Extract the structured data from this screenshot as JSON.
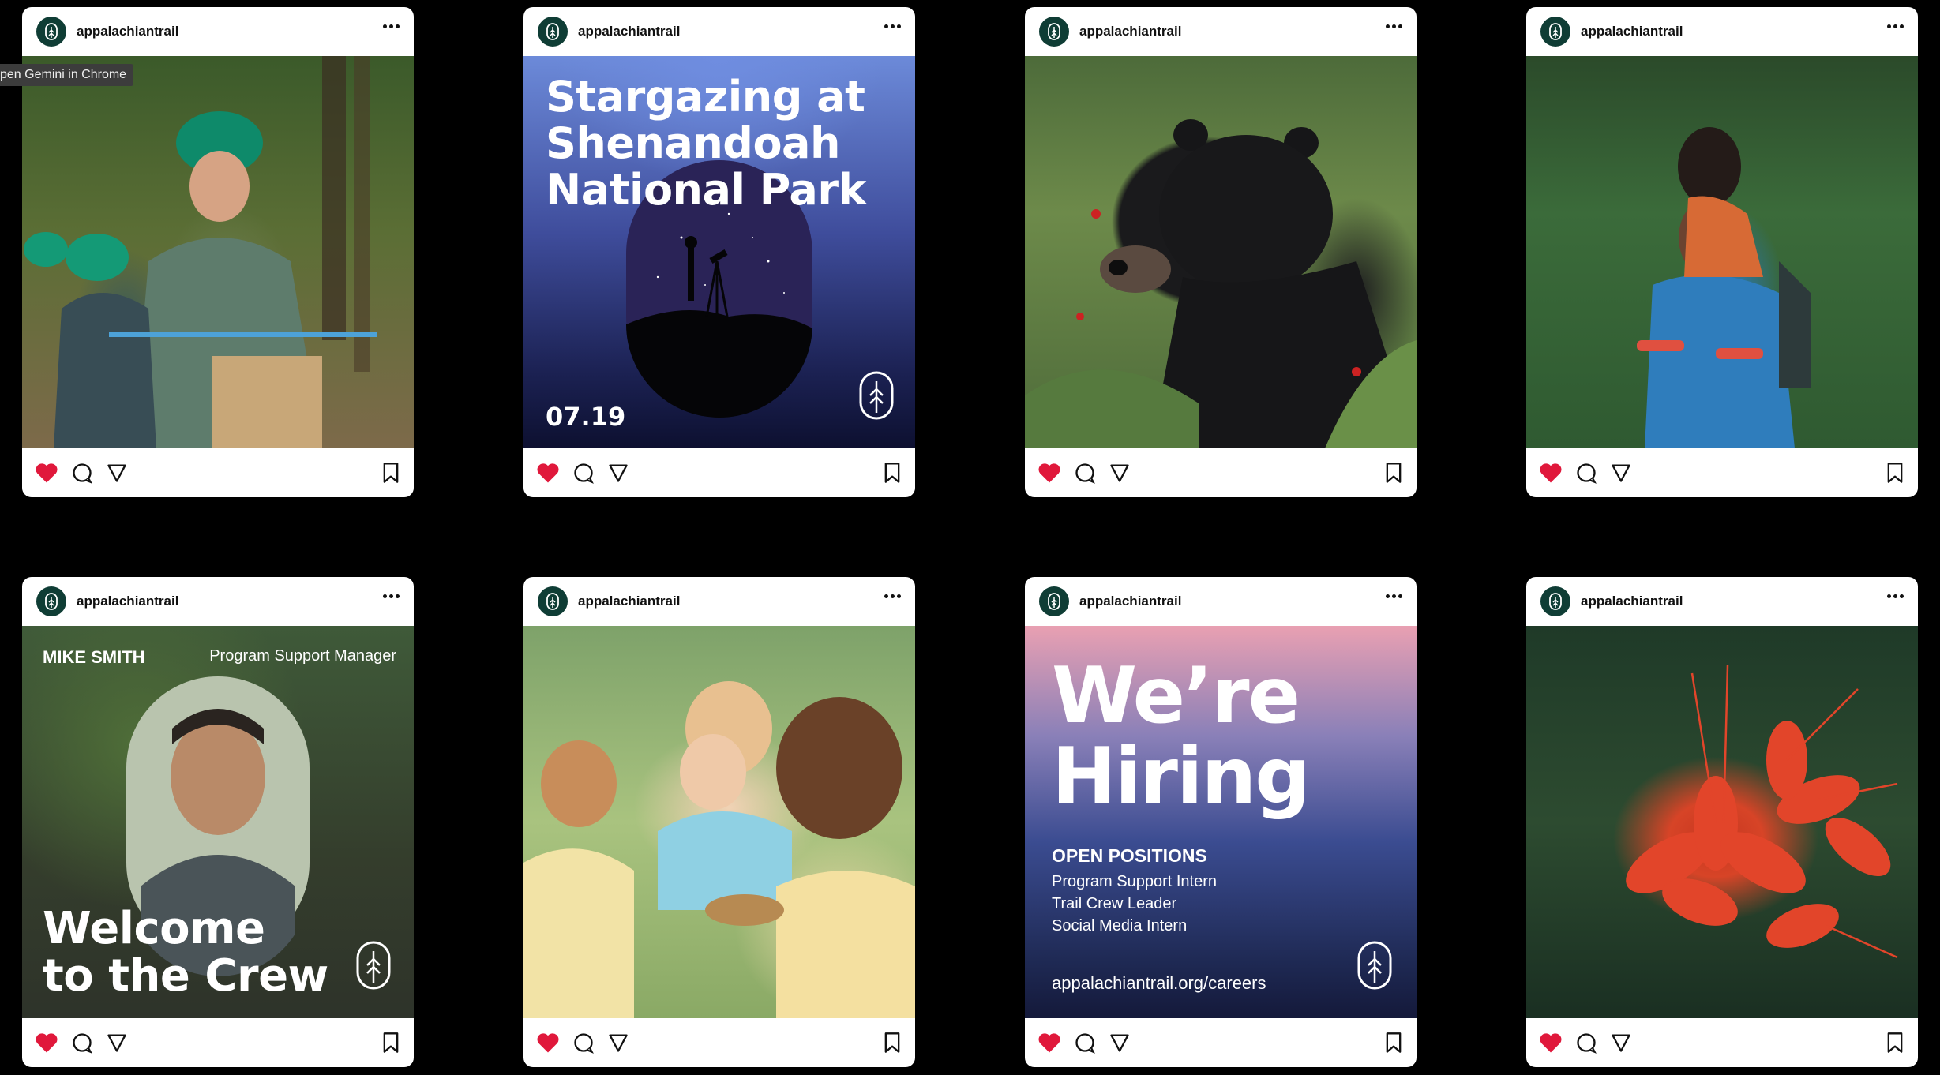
{
  "tooltip": "pen Gemini in Chrome",
  "posts": [
    {
      "username": "appalachiantrail"
    },
    {
      "username": "appalachiantrail",
      "title_lines": [
        "Stargazing at",
        "Shenandoah",
        "National Park"
      ],
      "date": "07.19"
    },
    {
      "username": "appalachiantrail"
    },
    {
      "username": "appalachiantrail"
    },
    {
      "username": "appalachiantrail",
      "name": "MIKE SMITH",
      "role": "Program Support Manager",
      "title_lines": [
        "Welcome",
        "to the Crew"
      ]
    },
    {
      "username": "appalachiantrail"
    },
    {
      "username": "appalachiantrail",
      "title_lines": [
        "We’re",
        "Hiring"
      ],
      "positions_heading": "OPEN POSITIONS",
      "positions": [
        "Program Support Intern",
        "Trail Crew Leader",
        "Social Media Intern"
      ],
      "url": "appalachiantrail.org/careers"
    },
    {
      "username": "appalachiantrail"
    }
  ],
  "colors": {
    "like": "#e0183b",
    "brand_green": "#0f3d35",
    "background": "#000000"
  },
  "icons": [
    "heart-icon",
    "comment-icon",
    "share-icon",
    "bookmark-icon",
    "more-icon",
    "trail-logo-icon"
  ]
}
